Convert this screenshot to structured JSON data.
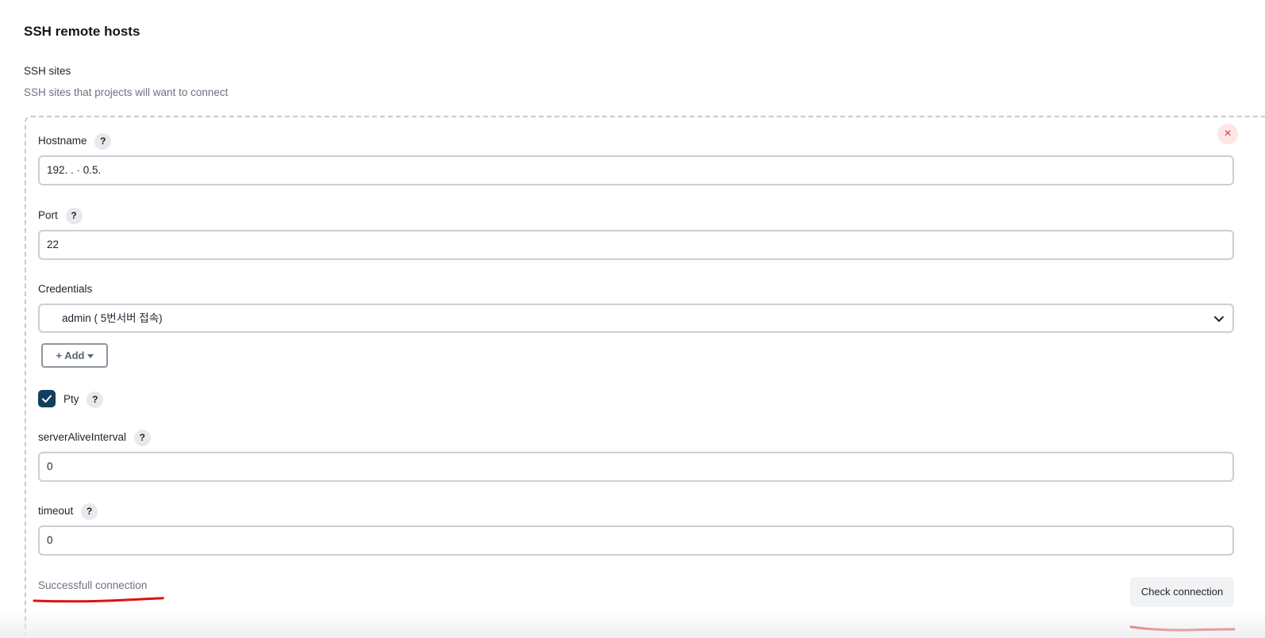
{
  "section": {
    "title": "SSH remote hosts",
    "sites_label": "SSH sites",
    "sites_description": "SSH sites that projects will want to connect"
  },
  "form": {
    "delete_icon": "×",
    "hostname": {
      "label": "Hostname",
      "value": "192.    .  ·  0.5."
    },
    "port": {
      "label": "Port",
      "value": "22"
    },
    "credentials": {
      "label": "Credentials",
      "selected": "admin (  5번서버 접속)",
      "add_label": "+ Add"
    },
    "pty": {
      "label": "Pty",
      "checked": true
    },
    "server_alive_interval": {
      "label": "serverAliveInterval",
      "value": "0"
    },
    "timeout": {
      "label": "timeout",
      "value": "0"
    },
    "help_glyph": "?",
    "status_text": "Successfull connection",
    "check_button": "Check connection"
  },
  "colors": {
    "checkbox": "#123f5e",
    "delete_bg": "#fde6e6",
    "delete_fg": "#e0303c",
    "annotation": "#e01010"
  },
  "icons": {
    "delete": "close-icon",
    "help": "help-icon",
    "dropdown": "chevron-down-icon",
    "checkbox": "check-icon"
  }
}
